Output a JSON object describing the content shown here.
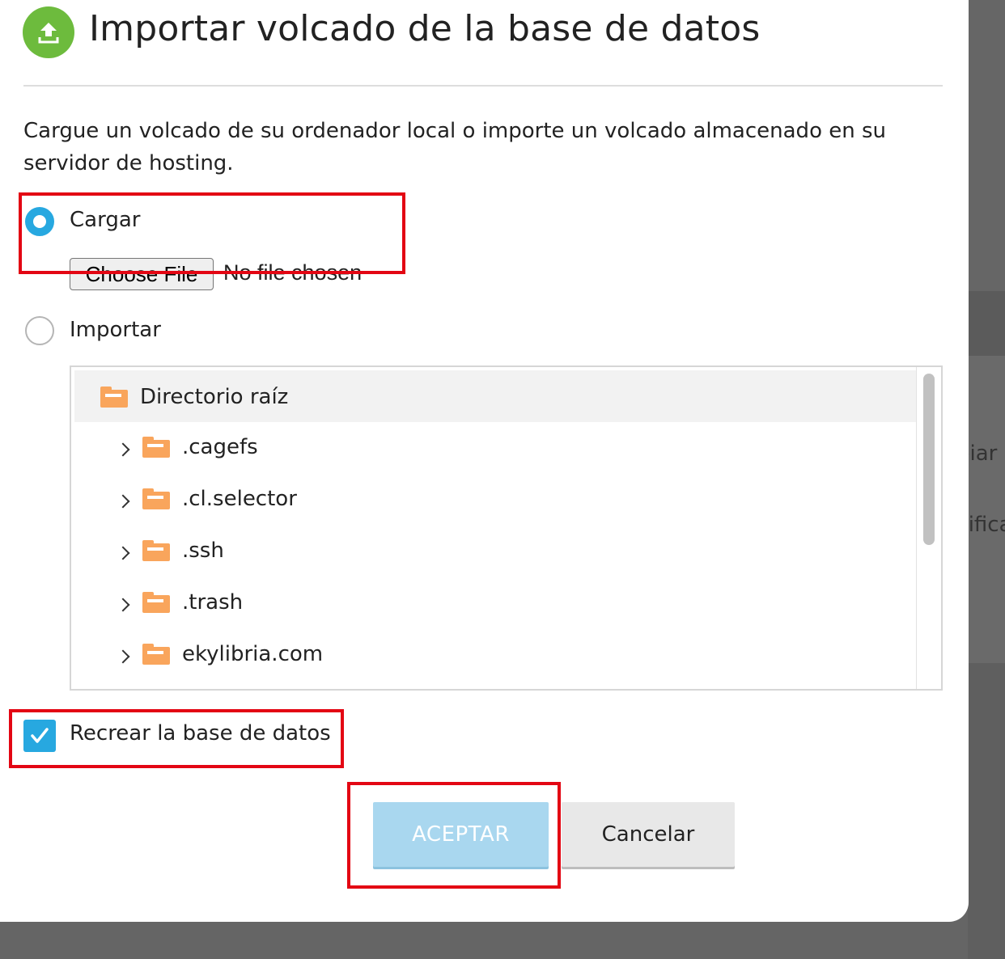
{
  "dialog": {
    "title": "Importar volcado de la base de datos",
    "title_icon": "upload-icon",
    "description": "Cargue un volcado de su ordenador local o importe un volcado almacenado en su servidor de hosting."
  },
  "source_options": [
    {
      "label": "Cargar",
      "selected": true
    },
    {
      "label": "Importar",
      "selected": false
    }
  ],
  "file_input": {
    "button_label": "Choose File",
    "status": "No file chosen"
  },
  "file_tree": {
    "root": {
      "label": "Directorio raíz",
      "icon": "folder-icon"
    },
    "items": [
      {
        "label": ".cagefs",
        "icon": "folder-icon"
      },
      {
        "label": ".cl.selector",
        "icon": "folder-icon"
      },
      {
        "label": ".ssh",
        "icon": "folder-icon"
      },
      {
        "label": ".trash",
        "icon": "folder-icon"
      },
      {
        "label": "ekylibria.com",
        "icon": "folder-icon"
      }
    ]
  },
  "recreate_db": {
    "label": "Recrear la base de datos",
    "checked": true
  },
  "buttons": {
    "ok": "ACEPTAR",
    "cancel": "Cancelar"
  },
  "background_fragments": [
    "biar",
    "rifica"
  ],
  "colors": {
    "accent": "#27a8e0",
    "ok_button": "#a9d7ef",
    "highlight_box": "#e30613",
    "folder": "#f9a55c",
    "title_icon": "#6dbb3d"
  }
}
